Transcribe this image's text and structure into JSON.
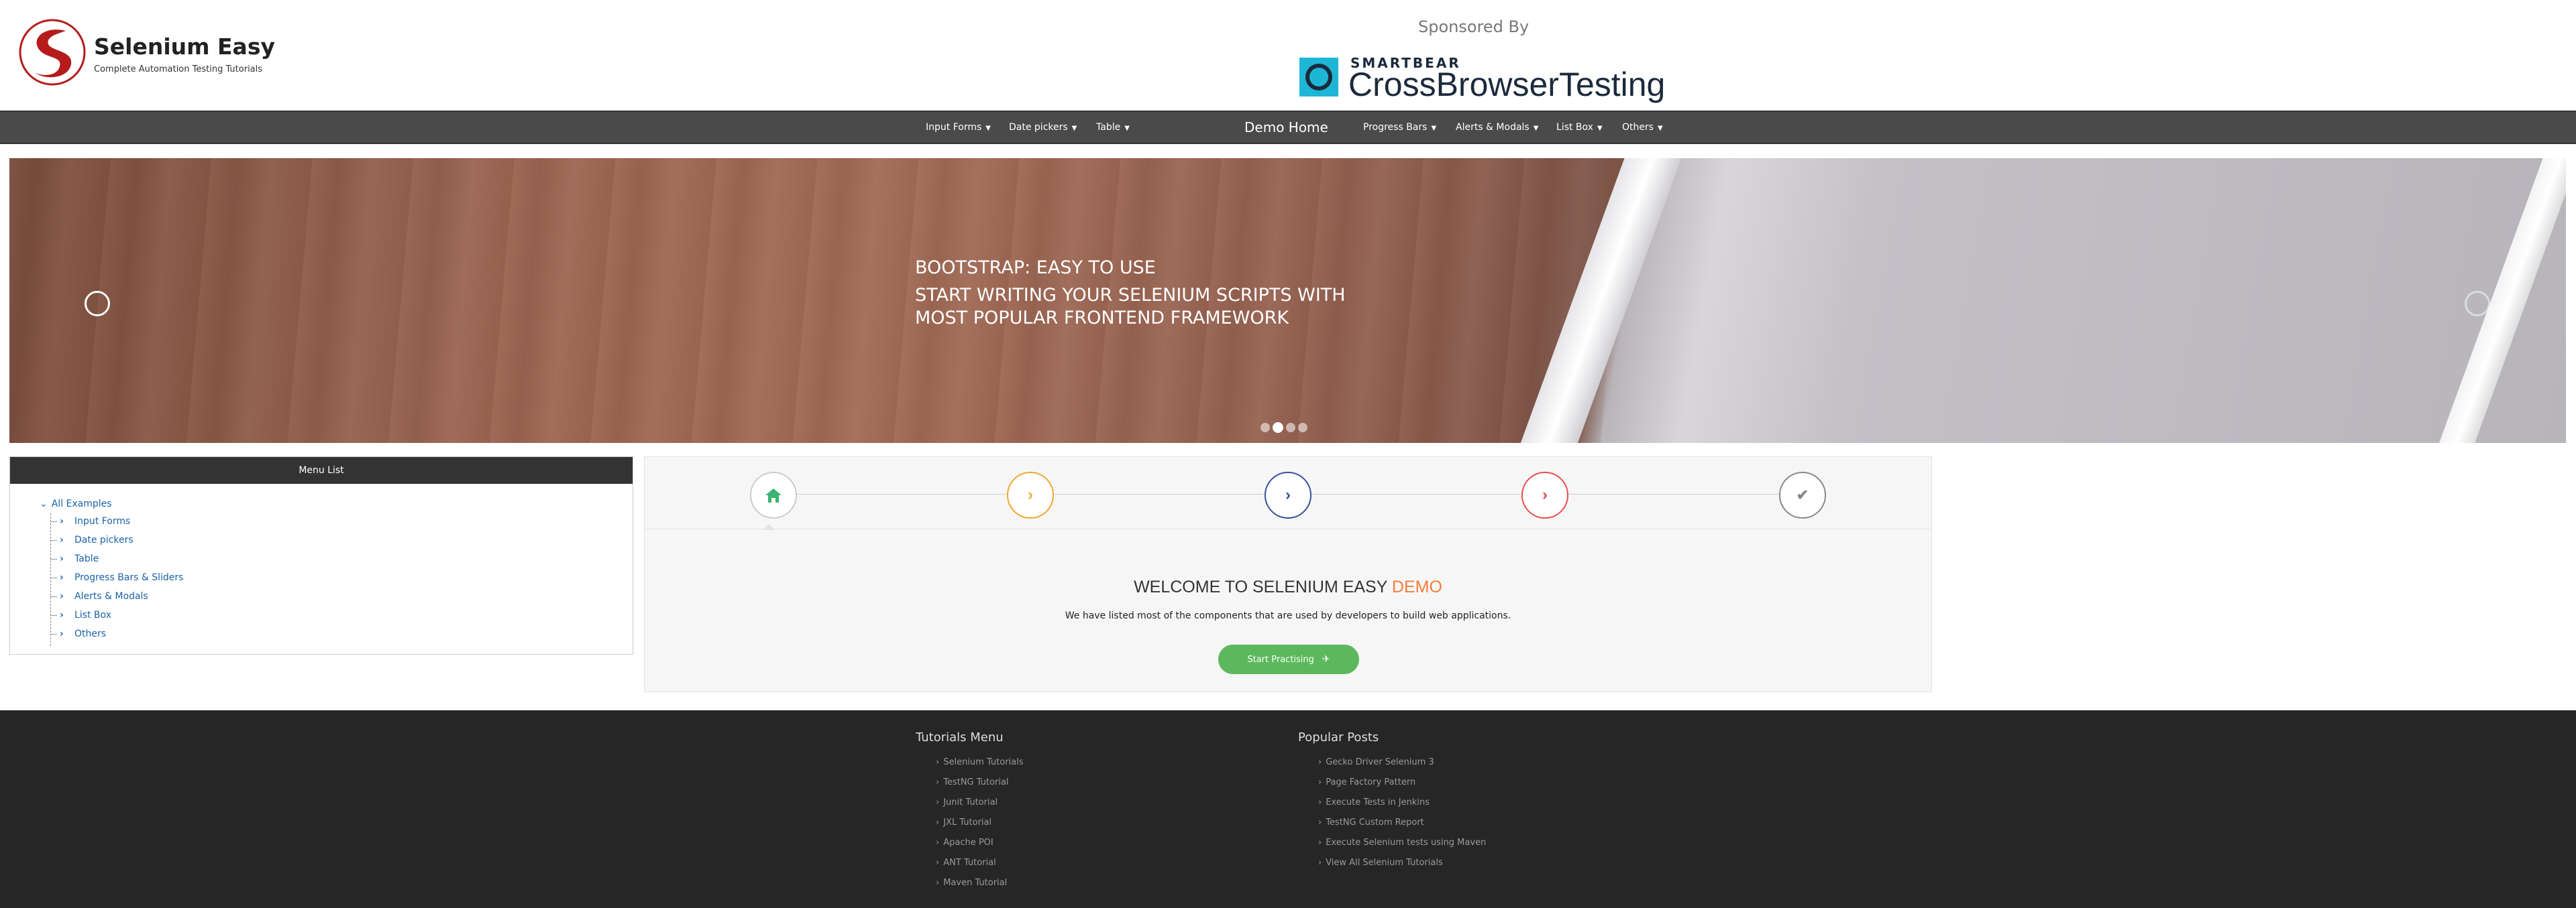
{
  "header": {
    "brand_title": "Selenium Easy",
    "brand_subtitle": "Complete Automation Testing Tutorials",
    "sponsored_label": "Sponsored By",
    "sponsor_top": "SMARTBEAR",
    "sponsor_name": "CrossBrowserTesting"
  },
  "navbar": {
    "left_items": [
      "Input Forms",
      "Date pickers",
      "Table"
    ],
    "home": "Demo Home",
    "right_items": [
      "Progress Bars",
      "Alerts & Modals",
      "List Box",
      "Others"
    ]
  },
  "carousel": {
    "heading": "BOOTSTRAP: EASY TO USE",
    "subheading": "START WRITING YOUR SELENIUM SCRIPTS WITH MOST POPULAR FRONTEND FRAMEWORK",
    "slide_count": 4,
    "active_slide": 2
  },
  "menu_list": {
    "title": "Menu List",
    "root": "All Examples",
    "items": [
      "Input Forms",
      "Date pickers",
      "Table",
      "Progress Bars & Sliders",
      "Alerts & Modals",
      "List Box",
      "Others"
    ]
  },
  "wizard": {
    "steps": [
      {
        "icon": "home-icon",
        "color": "#3cb371"
      },
      {
        "icon": "chevron-right-icon",
        "color": "#f0a830"
      },
      {
        "icon": "chevron-right-icon",
        "color": "#3a4f9a"
      },
      {
        "icon": "chevron-right-icon",
        "color": "#e84f4f"
      },
      {
        "icon": "check-icon",
        "color": "#888888"
      }
    ],
    "title_main": "WELCOME TO SELENIUM EASY",
    "title_accent": "DEMO",
    "description": "We have listed most of the components that are used by developers to build web applications.",
    "button_label": "Start Practising"
  },
  "footer": {
    "tutorials_title": "Tutorials Menu",
    "tutorials": [
      "Selenium Tutorials",
      "TestNG Tutorial",
      "Junit Tutorial",
      "JXL Tutorial",
      "Apache POI",
      "ANT Tutorial",
      "Maven Tutorial"
    ],
    "posts_title": "Popular Posts",
    "posts": [
      "Gecko Driver Selenium 3",
      "Page Factory Pattern",
      "Execute Tests in Jenkins",
      "TestNG Custom Report",
      "Execute Selenium tests using Maven",
      "View All Selenium Tutorials"
    ]
  },
  "colors": {
    "navbar": "#4a4a4a",
    "link": "#1a62a8",
    "accent": "#f47c3c",
    "button": "#5cb85c",
    "footer": "#262626"
  }
}
